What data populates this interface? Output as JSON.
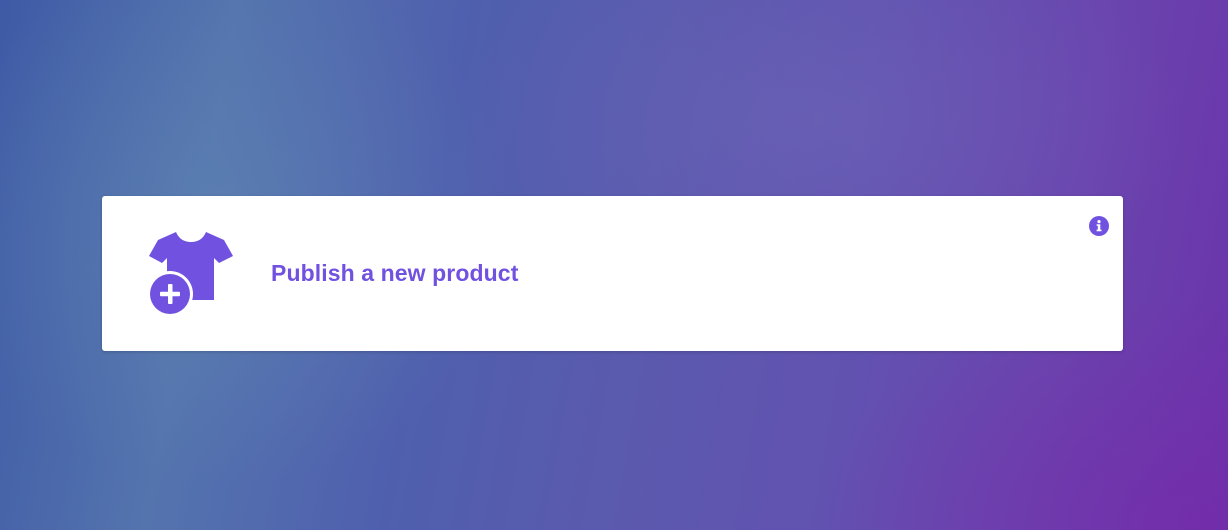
{
  "card": {
    "title": "Publish a new product",
    "icon": "tshirt-plus-icon",
    "info_icon": "info-icon"
  },
  "colors": {
    "accent": "#7152E0",
    "card_background": "#FFFFFF"
  }
}
